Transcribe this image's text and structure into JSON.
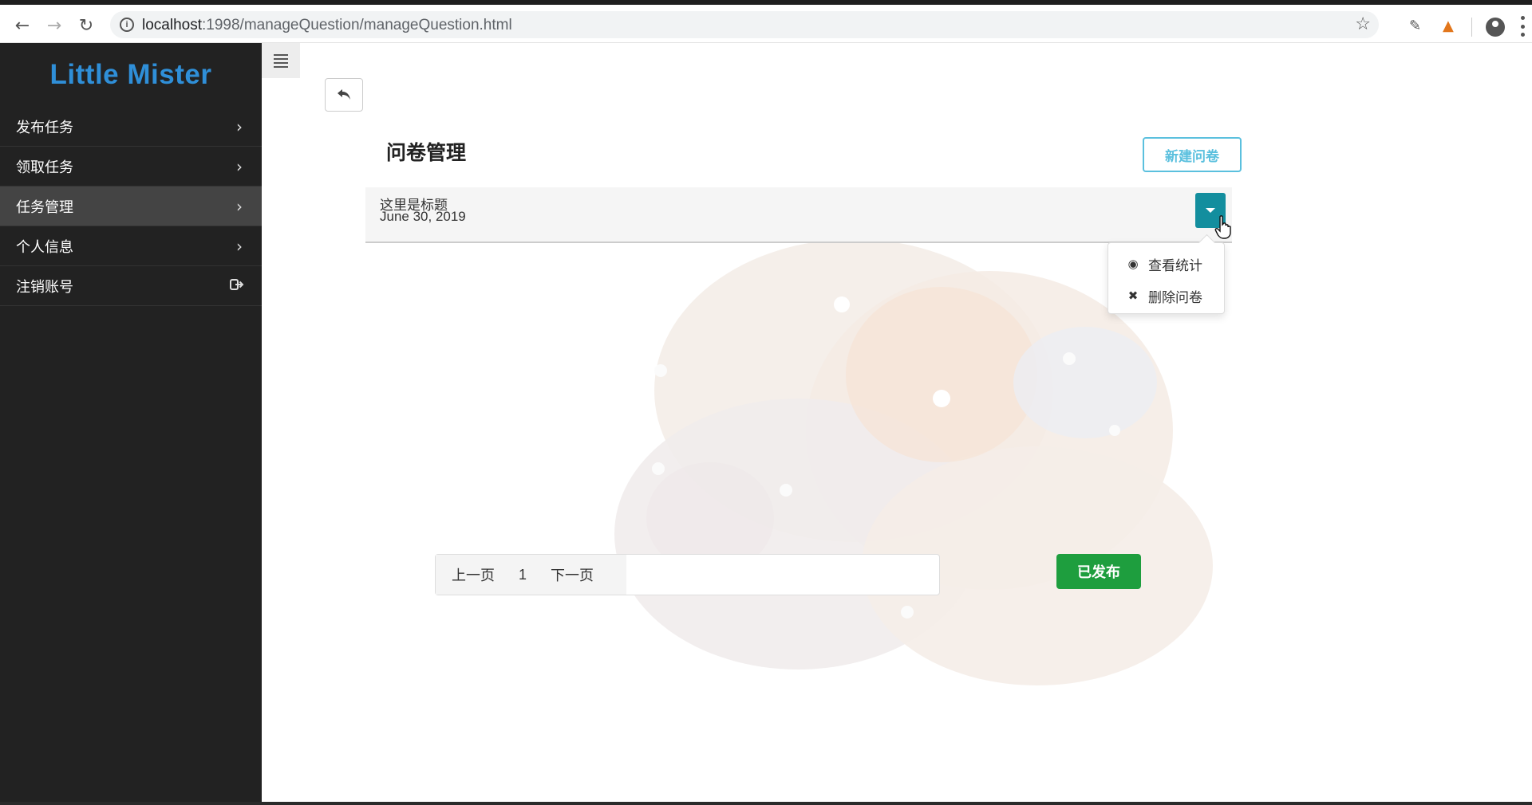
{
  "browser": {
    "url_host": "localhost",
    "url_rest": ":1998/manageQuestion/manageQuestion.html"
  },
  "sidebar": {
    "brand": "Little Mister",
    "items": [
      {
        "label": "发布任务",
        "icon": "chevron-right-icon"
      },
      {
        "label": "领取任务",
        "icon": "chevron-right-icon"
      },
      {
        "label": "任务管理",
        "icon": "chevron-right-icon",
        "active": true
      },
      {
        "label": "个人信息",
        "icon": "chevron-right-icon"
      },
      {
        "label": "注销账号",
        "icon": "sign-out-icon"
      }
    ]
  },
  "main": {
    "title": "问卷管理",
    "new_button": "新建问卷",
    "questionnaire": {
      "title": "这里是标题",
      "date": "June 30, 2019"
    },
    "dropdown": {
      "items": [
        {
          "label": "查看统计",
          "icon": "eye-icon"
        },
        {
          "label": "删除问卷",
          "icon": "close-icon"
        }
      ]
    },
    "pager": {
      "prev": "上一页",
      "page": "1",
      "next": "下一页"
    },
    "published_button": "已发布"
  },
  "colors": {
    "brand": "#2f8fd8",
    "sidebar_bg": "#222222",
    "new_button": "#5bc0de",
    "dropdown_button": "#138e9e",
    "published_button": "#1e9e3e"
  }
}
